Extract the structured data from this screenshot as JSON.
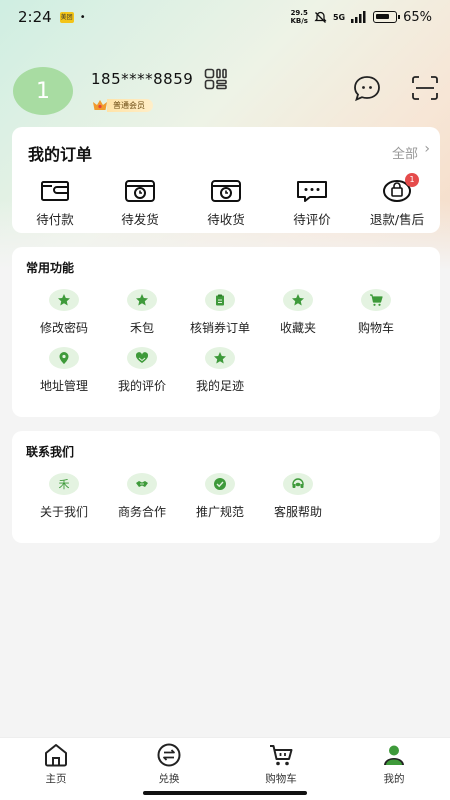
{
  "status_bar": {
    "time": "2:24",
    "app_badge": "美团",
    "dot": "•",
    "net_speed_value": "29.5",
    "net_speed_unit": "KB/s",
    "network": "5G",
    "battery": "65%"
  },
  "profile": {
    "avatar_text": "1",
    "phone": "185****8859",
    "member_label": "普通会员"
  },
  "orders": {
    "title": "我的订单",
    "all_label": "全部",
    "items": [
      {
        "label": "待付款",
        "icon": "wallet-icon"
      },
      {
        "label": "待发货",
        "icon": "box-clock-icon"
      },
      {
        "label": "待收货",
        "icon": "box-clock-icon"
      },
      {
        "label": "待评价",
        "icon": "comment-icon"
      },
      {
        "label": "退款/售后",
        "icon": "refund-bag-icon",
        "badge": "1"
      }
    ]
  },
  "functions": {
    "title": "常用功能",
    "items": [
      {
        "label": "修改密码",
        "icon": "star-icon"
      },
      {
        "label": "禾包",
        "icon": "star-icon"
      },
      {
        "label": "核销券订单",
        "icon": "clipboard-icon"
      },
      {
        "label": "收藏夹",
        "icon": "star-icon"
      },
      {
        "label": "购物车",
        "icon": "cart-icon"
      },
      {
        "label": "地址管理",
        "icon": "location-icon"
      },
      {
        "label": "我的评价",
        "icon": "heart-icon"
      },
      {
        "label": "我的足迹",
        "icon": "star-icon"
      }
    ]
  },
  "contact": {
    "title": "联系我们",
    "items": [
      {
        "label": "关于我们",
        "icon": "logo-glyph-icon",
        "glyph": "禾"
      },
      {
        "label": "商务合作",
        "icon": "handshake-icon"
      },
      {
        "label": "推广规范",
        "icon": "check-icon"
      },
      {
        "label": "客服帮助",
        "icon": "headset-icon"
      }
    ]
  },
  "bottom_nav": {
    "items": [
      {
        "label": "主页",
        "icon": "home-icon"
      },
      {
        "label": "兑换",
        "icon": "exchange-icon"
      },
      {
        "label": "购物车",
        "icon": "cart-icon"
      },
      {
        "label": "我的",
        "icon": "user-icon",
        "active": true
      }
    ]
  },
  "colors": {
    "accent_green": "#3e9a3a",
    "icon_bg": "#e4f3e1",
    "avatar_bg": "#a8dca2",
    "badge_red": "#e54b4b"
  }
}
